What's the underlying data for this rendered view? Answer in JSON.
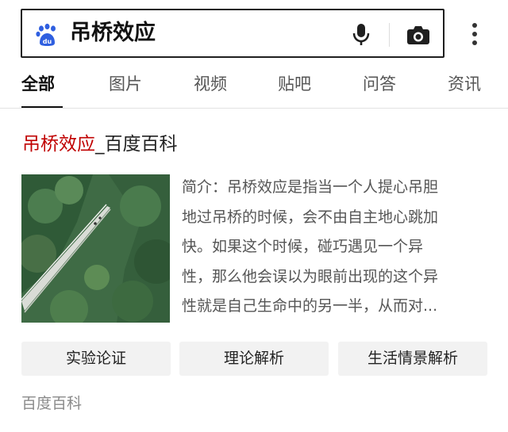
{
  "search": {
    "query": "吊桥效应"
  },
  "tabs": [
    {
      "label": "全部",
      "active": true
    },
    {
      "label": "图片"
    },
    {
      "label": "视频"
    },
    {
      "label": "贴吧"
    },
    {
      "label": "问答"
    },
    {
      "label": "资讯"
    }
  ],
  "result": {
    "title_highlight": "吊桥效应",
    "title_rest": "_百度百科",
    "summary_lines": [
      "简介：吊桥效应是指当一个人提心吊胆",
      "地过吊桥的时候，会不由自主地心跳加",
      "快。如果这个时候，碰巧遇见一个异",
      "性，那么他会误以为眼前出现的这个异",
      "性就是自己生命中的另一半，从而对..."
    ],
    "buttons": [
      "实验论证",
      "理论解析",
      "生活情景解析"
    ],
    "source": "百度百科"
  },
  "colors": {
    "accent": "#c00000",
    "logo_blue": "#2f5fe0"
  },
  "icons": {
    "logo": "baidu-paw-icon",
    "mic": "microphone-icon",
    "camera": "camera-icon",
    "more": "more-vertical-icon"
  }
}
